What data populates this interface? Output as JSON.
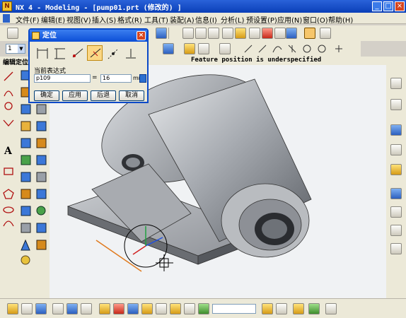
{
  "window": {
    "title": "NX 4 - Modeling - [pump01.prt  (修改的) ]",
    "icon": "nx-app-icon"
  },
  "menu": [
    "文件(F)",
    "编辑(E)",
    "视图(V)",
    "插入(S)",
    "格式(R)",
    "工具(T)",
    "装配(A)",
    "信息(I)",
    "分析(L)",
    "预设置(P)",
    "应用(N)",
    "窗口(O)",
    "帮助(H)"
  ],
  "layer_select": {
    "value": "1"
  },
  "status": {
    "left_label": "编辑定位",
    "message": "Feature position is underspecified"
  },
  "dialog": {
    "title": "定位",
    "close_label": "×",
    "tools": [
      "horizontal-dimension-icon",
      "vertical-dimension-icon",
      "parallel-at-distance-icon",
      "perpendicular-distance-icon",
      "point-onto-point-icon",
      "point-onto-line-icon"
    ],
    "active_tool_index": 3,
    "expression_label": "当前表达式",
    "expression_name": "p109",
    "equals": "=",
    "expression_value": "16",
    "unit": "mm",
    "buttons": {
      "ok": "确定",
      "apply": "应用",
      "back": "后退",
      "cancel": "取消"
    }
  },
  "colors": {
    "titlebar": "#0a3fb8",
    "viewport_bg": "#f0f2f4",
    "model_gray": "#9a9da3",
    "edge_orange": "#e07a1e"
  }
}
